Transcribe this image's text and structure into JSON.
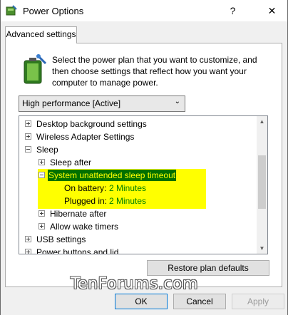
{
  "window": {
    "title": "Power Options",
    "help_label": "?",
    "close_label": "✕"
  },
  "tab": {
    "label": "Advanced settings"
  },
  "description": "Select the power plan that you want to customize, and then choose settings that reflect how you want your computer to manage power.",
  "plan_select": {
    "value": "High performance [Active]",
    "arrow": "⌄"
  },
  "tree": {
    "items": [
      {
        "label": "Desktop background settings"
      },
      {
        "label": "Wireless Adapter Settings"
      },
      {
        "label": "Sleep"
      },
      {
        "label": "Sleep after"
      },
      {
        "label": "System unattended sleep timeout"
      },
      {
        "label": "On battery:",
        "value": "2 Minutes"
      },
      {
        "label": "Plugged in:",
        "value": "2 Minutes"
      },
      {
        "label": "Hibernate after"
      },
      {
        "label": "Allow wake timers"
      },
      {
        "label": "USB settings"
      },
      {
        "label": "Power buttons and lid"
      }
    ]
  },
  "buttons": {
    "restore": "Restore plan defaults",
    "ok": "OK",
    "cancel": "Cancel",
    "apply": "Apply"
  },
  "watermark": "TenForums.com",
  "colors": {
    "highlight": "#ffff00",
    "selection": "#007000",
    "value_text": "#008000"
  }
}
